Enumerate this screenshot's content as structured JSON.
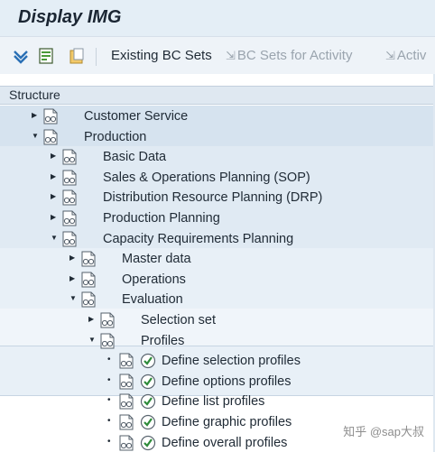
{
  "window": {
    "title": "Display IMG"
  },
  "toolbar": {
    "expand_icon": "expand-subtree-icon",
    "doc_icon": "document-green-icon",
    "folder_icon": "folder-clipboard-icon",
    "existing_bc_sets": "Existing BC Sets",
    "bc_sets_for_activity": "BC Sets for Activity",
    "activ_truncated": "Activ"
  },
  "structure_header": "Structure",
  "tree": [
    {
      "label": "Customer Service",
      "state": "collapsed",
      "level": 0
    },
    {
      "label": "Production",
      "state": "expanded",
      "level": 0
    },
    {
      "label": "Basic Data",
      "state": "collapsed",
      "level": 1
    },
    {
      "label": "Sales & Operations Planning (SOP)",
      "state": "collapsed",
      "level": 1
    },
    {
      "label": "Distribution Resource Planning (DRP)",
      "state": "collapsed",
      "level": 1
    },
    {
      "label": "Production Planning",
      "state": "collapsed",
      "level": 1
    },
    {
      "label": "Capacity Requirements Planning",
      "state": "expanded",
      "level": 1
    },
    {
      "label": "Master data",
      "state": "collapsed",
      "level": 2
    },
    {
      "label": "Operations",
      "state": "collapsed",
      "level": 2
    },
    {
      "label": "Evaluation",
      "state": "expanded",
      "level": 2
    },
    {
      "label": "Selection set",
      "state": "collapsed",
      "level": 3
    },
    {
      "label": "Profiles",
      "state": "expanded",
      "level": 3
    },
    {
      "label": "Define selection profiles",
      "state": "leaf",
      "level": 4
    },
    {
      "label": "Define options profiles",
      "state": "leaf",
      "level": 4
    },
    {
      "label": "Define list profiles",
      "state": "leaf",
      "level": 4
    },
    {
      "label": "Define graphic profiles",
      "state": "leaf",
      "level": 4
    },
    {
      "label": "Define overall profiles",
      "state": "leaf",
      "level": 4
    }
  ],
  "watermark": "知乎 @sap大叔",
  "colors": {
    "band_level_0": "#d6e3ef",
    "band_level_1": "#e0eaf3",
    "band_level_2": "#e8f0f7",
    "band_level_3": "#f0f5fa",
    "leaf_icon_green": "#2e8b3a"
  }
}
